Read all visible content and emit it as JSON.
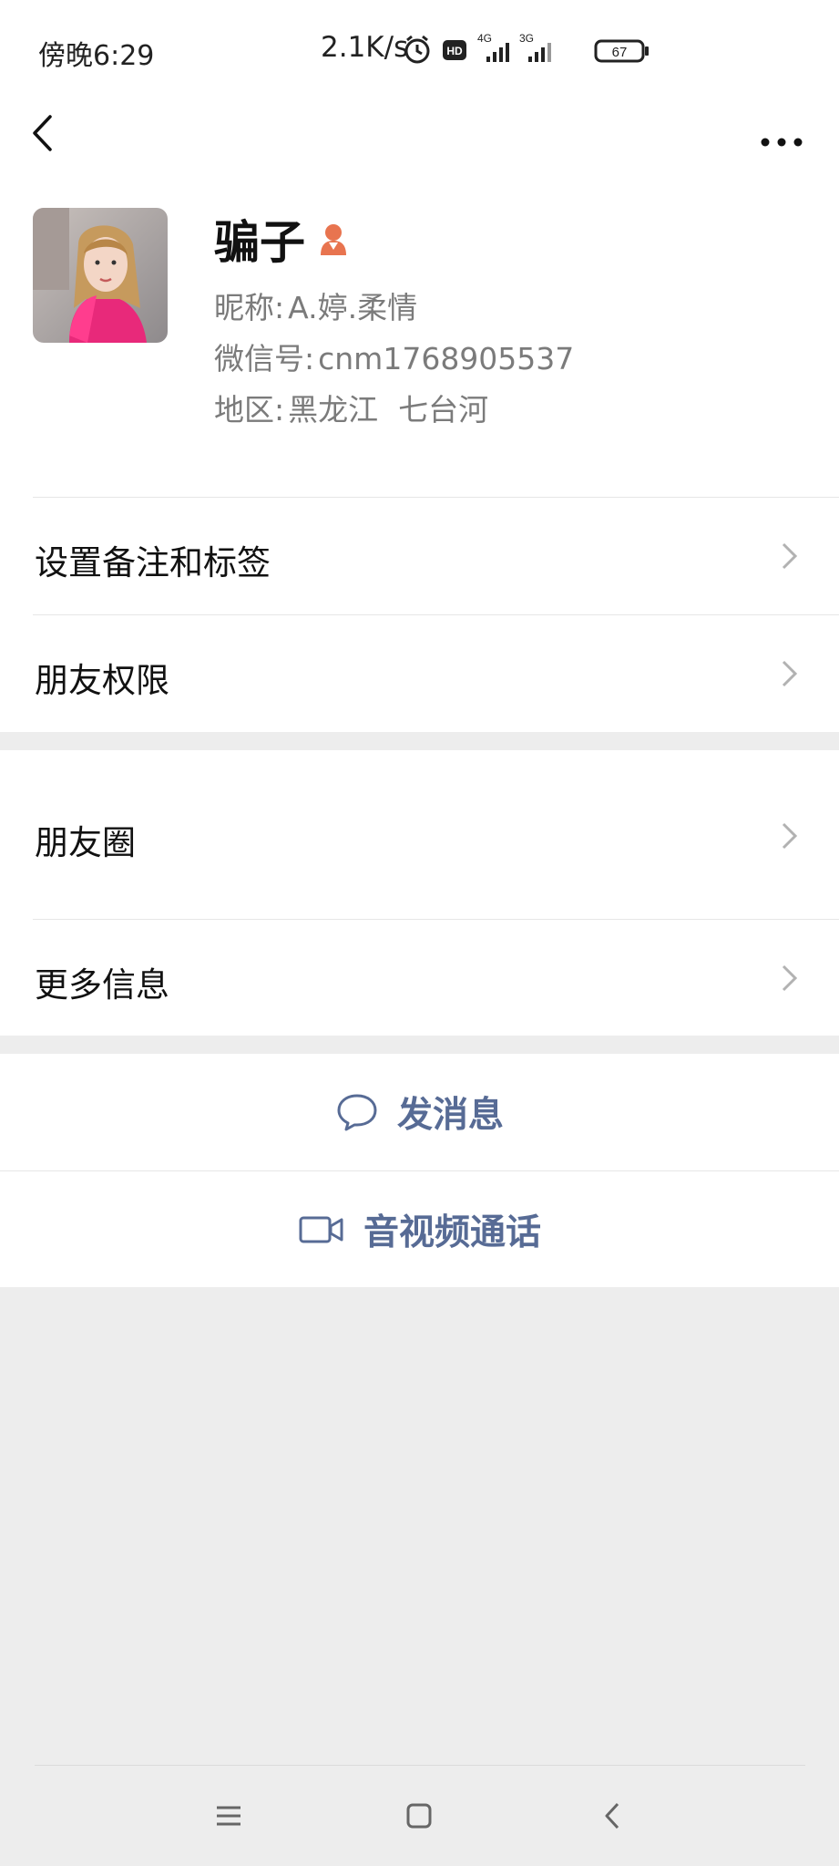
{
  "status_bar": {
    "time": "傍晚6:29",
    "net_speed": "2.1K/s",
    "hd_badge": "HD",
    "sim1_label": "4G",
    "sim2_label": "3G",
    "battery": "67",
    "icons": [
      "alarm-icon",
      "hd-icon",
      "signal-4g-icon",
      "signal-3g-icon",
      "battery-icon"
    ]
  },
  "nav": {
    "back_icon": "chevron-left-icon",
    "more_icon": "more-dots-icon"
  },
  "profile": {
    "name": "骗子",
    "gender_icon": "female-icon",
    "nickname_label": "昵称:",
    "nickname": "A.婷.柔情",
    "wechat_id_label": "微信号:",
    "wechat_id": "cnm1768905537",
    "region_label": "地区:",
    "region_province": "黑龙江",
    "region_city": "七台河"
  },
  "menu": {
    "remark_tags": "设置备注和标签",
    "permissions": "朋友权限",
    "moments": "朋友圈",
    "more_info": "更多信息"
  },
  "actions": {
    "send_message": "发消息",
    "video_call": "音视频通话"
  },
  "colors": {
    "link_blue": "#576b95",
    "gender_orange": "#e8744f",
    "page_gray": "#ededed"
  }
}
